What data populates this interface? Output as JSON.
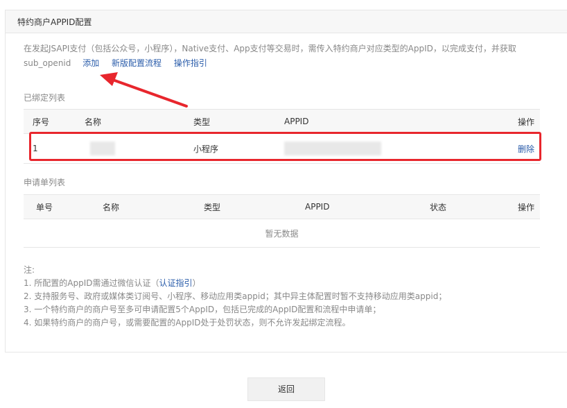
{
  "panel": {
    "title": "特约商户APPID配置"
  },
  "description": {
    "text_line1": "在发起JSAPI支付（包括公众号，小程序），Native支付、App支付等交易时，需传入特约商户对应类型的AppID，以完成支付，并获取",
    "text_line2": "sub_openid",
    "links": [
      "添加",
      "新版配置流程",
      "操作指引"
    ]
  },
  "bound_list": {
    "title": "已绑定列表",
    "columns": [
      "序号",
      "名称",
      "类型",
      "APPID",
      "操作"
    ],
    "rows": [
      {
        "seq": "1",
        "type": "小程序",
        "action": "删除"
      }
    ]
  },
  "application_list": {
    "title": "申请单列表",
    "columns": [
      "单号",
      "名称",
      "类型",
      "APPID",
      "状态",
      "操作"
    ],
    "empty_text": "暂无数据"
  },
  "notes": {
    "label": "注:",
    "items": [
      {
        "text": "1. 所配置的AppID需通过微信认证（",
        "link": "认证指引",
        "suffix": "）"
      },
      {
        "text": "2. 支持服务号、政府或媒体类订阅号、小程序、移动应用类appid；其中异主体配置时暂不支持移动应用类appid；"
      },
      {
        "text": "3. 一个特约商户的商户号至多可申请配置5个AppID，包括已完成的AppID配置和流程中申请单；"
      },
      {
        "text": "4. 如果特约商户的商户号，或需要配置的AppID处于处罚状态，则不允许发起绑定流程。"
      }
    ]
  },
  "footer": {
    "back_label": "返回"
  },
  "colors": {
    "link": "#2a5caa",
    "highlight": "#e8262d"
  }
}
